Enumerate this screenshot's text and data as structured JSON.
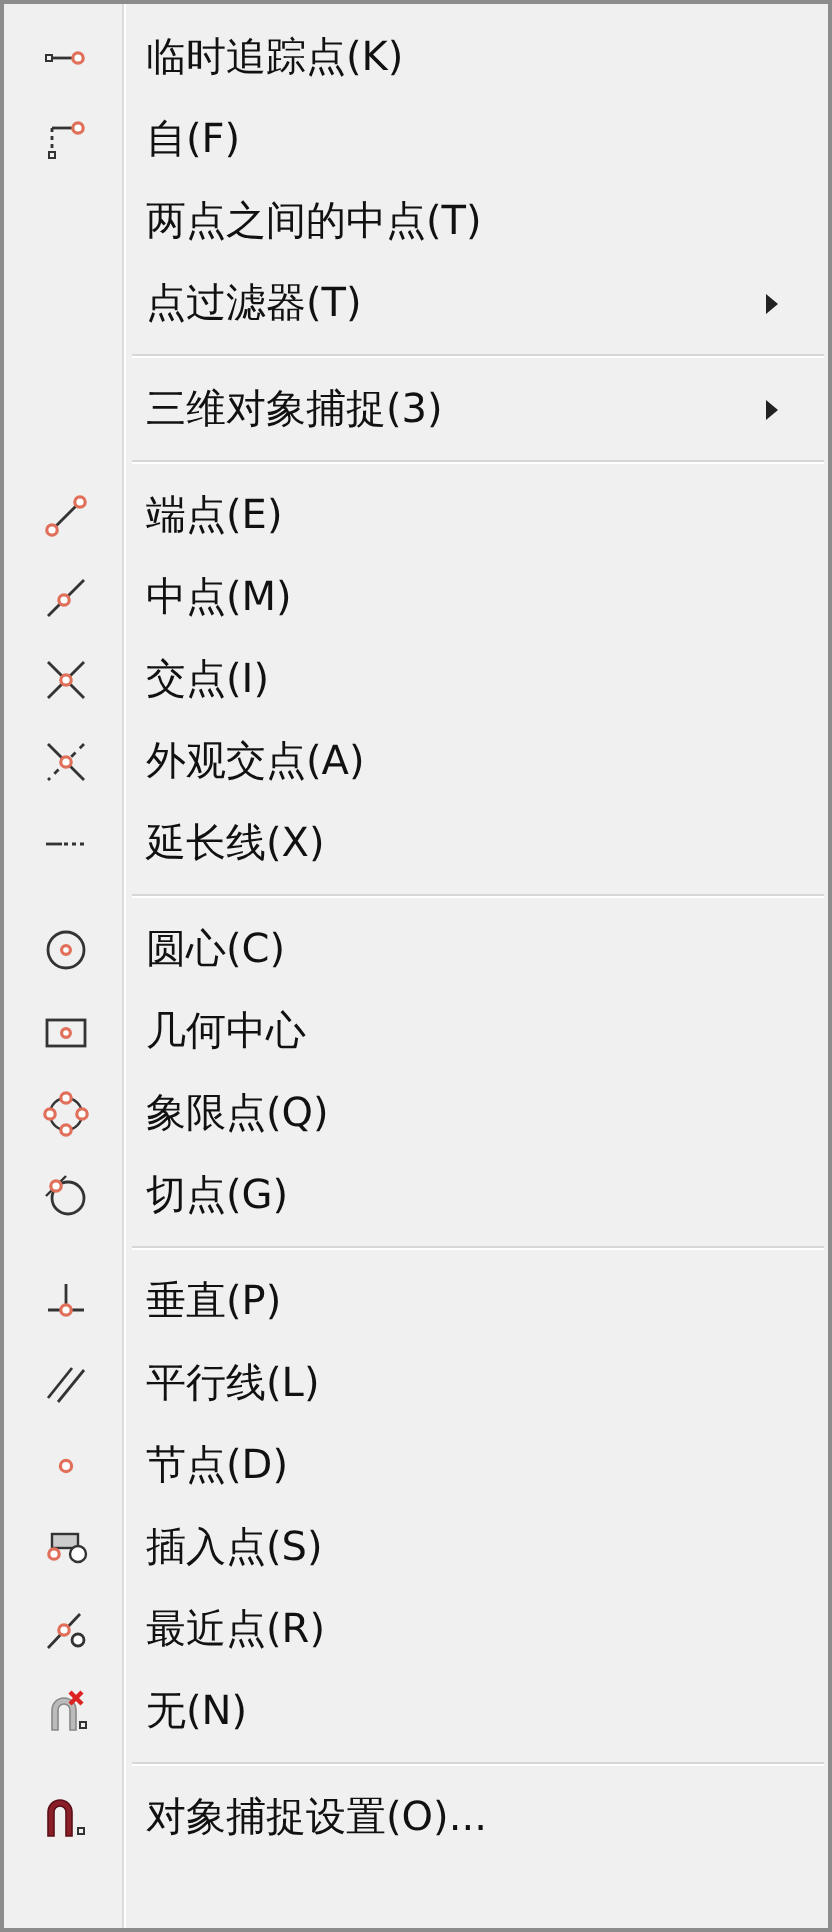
{
  "menu": {
    "groups": [
      {
        "items": [
          {
            "label": "临时追踪点(K)",
            "kind": "tracking",
            "has_submenu": false
          },
          {
            "label": "自(F)",
            "kind": "from",
            "has_submenu": false
          },
          {
            "label": "两点之间的中点(T)",
            "kind": "plain",
            "has_submenu": false
          },
          {
            "label": "点过滤器(T)",
            "kind": "plain",
            "has_submenu": true
          }
        ]
      },
      {
        "items": [
          {
            "label": "三维对象捕捉(3)",
            "kind": "plain",
            "has_submenu": true
          }
        ]
      },
      {
        "items": [
          {
            "label": "端点(E)",
            "kind": "endpoint",
            "has_submenu": false
          },
          {
            "label": "中点(M)",
            "kind": "midpoint",
            "has_submenu": false
          },
          {
            "label": "交点(I)",
            "kind": "intersection",
            "has_submenu": false
          },
          {
            "label": "外观交点(A)",
            "kind": "apparent",
            "has_submenu": false
          },
          {
            "label": "延长线(X)",
            "kind": "extension",
            "has_submenu": false
          }
        ]
      },
      {
        "items": [
          {
            "label": "圆心(C)",
            "kind": "center",
            "has_submenu": false
          },
          {
            "label": "几何中心",
            "kind": "geocenter",
            "has_submenu": false
          },
          {
            "label": "象限点(Q)",
            "kind": "quadrant",
            "has_submenu": false
          },
          {
            "label": "切点(G)",
            "kind": "tangent",
            "has_submenu": false
          }
        ]
      },
      {
        "items": [
          {
            "label": "垂直(P)",
            "kind": "perpendicular",
            "has_submenu": false
          },
          {
            "label": "平行线(L)",
            "kind": "parallel",
            "has_submenu": false
          },
          {
            "label": "节点(D)",
            "kind": "node",
            "has_submenu": false
          },
          {
            "label": "插入点(S)",
            "kind": "insertion",
            "has_submenu": false
          },
          {
            "label": "最近点(R)",
            "kind": "nearest",
            "has_submenu": false
          },
          {
            "label": "无(N)",
            "kind": "none",
            "has_submenu": false
          }
        ]
      },
      {
        "items": [
          {
            "label": "对象捕捉设置(O)...",
            "kind": "settings",
            "has_submenu": false
          }
        ]
      }
    ]
  }
}
